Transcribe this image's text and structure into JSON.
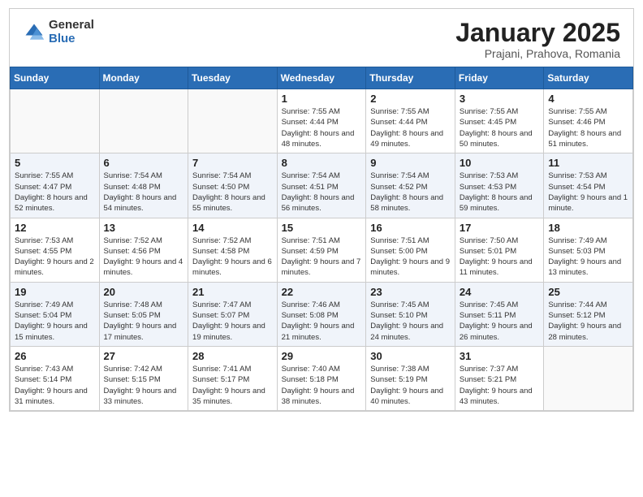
{
  "logo": {
    "general": "General",
    "blue": "Blue"
  },
  "title": {
    "month": "January 2025",
    "location": "Prajani, Prahova, Romania"
  },
  "weekdays": [
    "Sunday",
    "Monday",
    "Tuesday",
    "Wednesday",
    "Thursday",
    "Friday",
    "Saturday"
  ],
  "weeks": [
    [
      {
        "day": "",
        "info": ""
      },
      {
        "day": "",
        "info": ""
      },
      {
        "day": "",
        "info": ""
      },
      {
        "day": "1",
        "info": "Sunrise: 7:55 AM\nSunset: 4:44 PM\nDaylight: 8 hours and 48 minutes."
      },
      {
        "day": "2",
        "info": "Sunrise: 7:55 AM\nSunset: 4:44 PM\nDaylight: 8 hours and 49 minutes."
      },
      {
        "day": "3",
        "info": "Sunrise: 7:55 AM\nSunset: 4:45 PM\nDaylight: 8 hours and 50 minutes."
      },
      {
        "day": "4",
        "info": "Sunrise: 7:55 AM\nSunset: 4:46 PM\nDaylight: 8 hours and 51 minutes."
      }
    ],
    [
      {
        "day": "5",
        "info": "Sunrise: 7:55 AM\nSunset: 4:47 PM\nDaylight: 8 hours and 52 minutes."
      },
      {
        "day": "6",
        "info": "Sunrise: 7:54 AM\nSunset: 4:48 PM\nDaylight: 8 hours and 54 minutes."
      },
      {
        "day": "7",
        "info": "Sunrise: 7:54 AM\nSunset: 4:50 PM\nDaylight: 8 hours and 55 minutes."
      },
      {
        "day": "8",
        "info": "Sunrise: 7:54 AM\nSunset: 4:51 PM\nDaylight: 8 hours and 56 minutes."
      },
      {
        "day": "9",
        "info": "Sunrise: 7:54 AM\nSunset: 4:52 PM\nDaylight: 8 hours and 58 minutes."
      },
      {
        "day": "10",
        "info": "Sunrise: 7:53 AM\nSunset: 4:53 PM\nDaylight: 8 hours and 59 minutes."
      },
      {
        "day": "11",
        "info": "Sunrise: 7:53 AM\nSunset: 4:54 PM\nDaylight: 9 hours and 1 minute."
      }
    ],
    [
      {
        "day": "12",
        "info": "Sunrise: 7:53 AM\nSunset: 4:55 PM\nDaylight: 9 hours and 2 minutes."
      },
      {
        "day": "13",
        "info": "Sunrise: 7:52 AM\nSunset: 4:56 PM\nDaylight: 9 hours and 4 minutes."
      },
      {
        "day": "14",
        "info": "Sunrise: 7:52 AM\nSunset: 4:58 PM\nDaylight: 9 hours and 6 minutes."
      },
      {
        "day": "15",
        "info": "Sunrise: 7:51 AM\nSunset: 4:59 PM\nDaylight: 9 hours and 7 minutes."
      },
      {
        "day": "16",
        "info": "Sunrise: 7:51 AM\nSunset: 5:00 PM\nDaylight: 9 hours and 9 minutes."
      },
      {
        "day": "17",
        "info": "Sunrise: 7:50 AM\nSunset: 5:01 PM\nDaylight: 9 hours and 11 minutes."
      },
      {
        "day": "18",
        "info": "Sunrise: 7:49 AM\nSunset: 5:03 PM\nDaylight: 9 hours and 13 minutes."
      }
    ],
    [
      {
        "day": "19",
        "info": "Sunrise: 7:49 AM\nSunset: 5:04 PM\nDaylight: 9 hours and 15 minutes."
      },
      {
        "day": "20",
        "info": "Sunrise: 7:48 AM\nSunset: 5:05 PM\nDaylight: 9 hours and 17 minutes."
      },
      {
        "day": "21",
        "info": "Sunrise: 7:47 AM\nSunset: 5:07 PM\nDaylight: 9 hours and 19 minutes."
      },
      {
        "day": "22",
        "info": "Sunrise: 7:46 AM\nSunset: 5:08 PM\nDaylight: 9 hours and 21 minutes."
      },
      {
        "day": "23",
        "info": "Sunrise: 7:45 AM\nSunset: 5:10 PM\nDaylight: 9 hours and 24 minutes."
      },
      {
        "day": "24",
        "info": "Sunrise: 7:45 AM\nSunset: 5:11 PM\nDaylight: 9 hours and 26 minutes."
      },
      {
        "day": "25",
        "info": "Sunrise: 7:44 AM\nSunset: 5:12 PM\nDaylight: 9 hours and 28 minutes."
      }
    ],
    [
      {
        "day": "26",
        "info": "Sunrise: 7:43 AM\nSunset: 5:14 PM\nDaylight: 9 hours and 31 minutes."
      },
      {
        "day": "27",
        "info": "Sunrise: 7:42 AM\nSunset: 5:15 PM\nDaylight: 9 hours and 33 minutes."
      },
      {
        "day": "28",
        "info": "Sunrise: 7:41 AM\nSunset: 5:17 PM\nDaylight: 9 hours and 35 minutes."
      },
      {
        "day": "29",
        "info": "Sunrise: 7:40 AM\nSunset: 5:18 PM\nDaylight: 9 hours and 38 minutes."
      },
      {
        "day": "30",
        "info": "Sunrise: 7:38 AM\nSunset: 5:19 PM\nDaylight: 9 hours and 40 minutes."
      },
      {
        "day": "31",
        "info": "Sunrise: 7:37 AM\nSunset: 5:21 PM\nDaylight: 9 hours and 43 minutes."
      },
      {
        "day": "",
        "info": ""
      }
    ]
  ]
}
